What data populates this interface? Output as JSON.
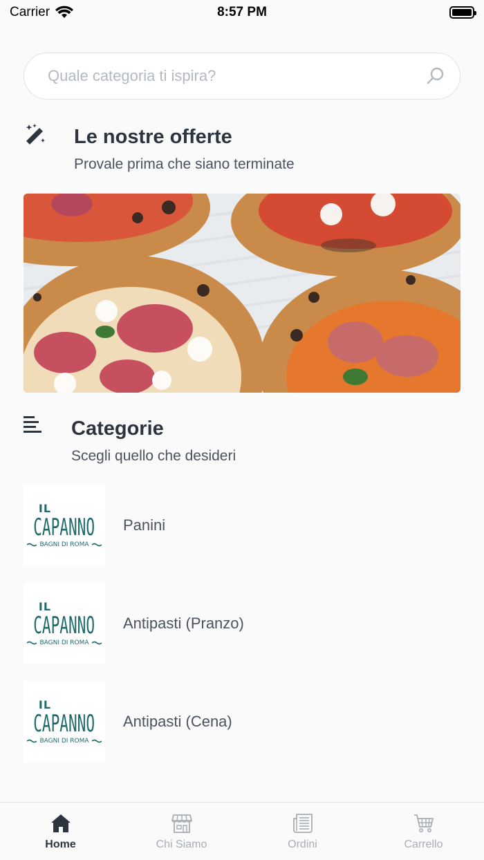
{
  "status_bar": {
    "carrier": "Carrier",
    "time": "8:57 PM"
  },
  "search": {
    "placeholder": "Quale categoria ti ispira?"
  },
  "offers": {
    "icon": "magic-wand-icon",
    "title": "Le nostre offerte",
    "subtitle": "Provale prima che siano terminate",
    "banner": "pizza-photo"
  },
  "categories": {
    "icon": "list-lines-icon",
    "title": "Categorie",
    "subtitle": "Scegli quello che desideri",
    "logo": {
      "line1": "IL",
      "line2": "CAPANNO",
      "line3": "BAGNI DI ROMA"
    },
    "items": [
      {
        "label": "Panini"
      },
      {
        "label": "Antipasti (Pranzo)"
      },
      {
        "label": "Antipasti (Cena)"
      }
    ]
  },
  "tab_bar": {
    "tabs": [
      {
        "label": "Home",
        "icon": "home-icon",
        "active": true
      },
      {
        "label": "Chi Siamo",
        "icon": "store-icon",
        "active": false
      },
      {
        "label": "Ordini",
        "icon": "orders-icon",
        "active": false
      },
      {
        "label": "Carrello",
        "icon": "cart-icon",
        "active": false
      }
    ]
  },
  "colors": {
    "text_dark": "#2c3440",
    "text_muted": "#4a5260",
    "tab_inactive": "#a7adb5",
    "logo_teal": "#1c6a6a"
  }
}
